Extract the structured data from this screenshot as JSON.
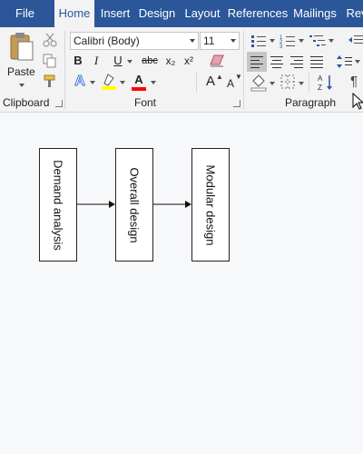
{
  "tabs": [
    {
      "label": "File"
    },
    {
      "label": "Home"
    },
    {
      "label": "Insert"
    },
    {
      "label": "Design"
    },
    {
      "label": "Layout"
    },
    {
      "label": "References"
    },
    {
      "label": "Mailings"
    },
    {
      "label": "Rev"
    }
  ],
  "ribbon": {
    "clipboard": {
      "group_label": "Clipboard",
      "paste_label": "Paste"
    },
    "font": {
      "group_label": "Font",
      "font_name": "Calibri (Body)",
      "font_size": "11",
      "bold": "B",
      "italic": "I",
      "underline": "U",
      "strikethrough": "abc",
      "subscript": "x₂",
      "superscript": "x²",
      "text_effects": "A",
      "font_color": "A",
      "grow_font": "A",
      "shrink_font": "A"
    },
    "paragraph": {
      "group_label": "Paragraph",
      "pilcrow": "¶"
    }
  },
  "document": {
    "boxes": [
      {
        "label": "Demand analysis"
      },
      {
        "label": "Overall design"
      },
      {
        "label": "Modular design"
      }
    ]
  },
  "colors": {
    "tabbar": "#2b579a",
    "ribbon": "#f3f3f3",
    "highlight": "#ffff00",
    "font_color": "#ff0000"
  }
}
